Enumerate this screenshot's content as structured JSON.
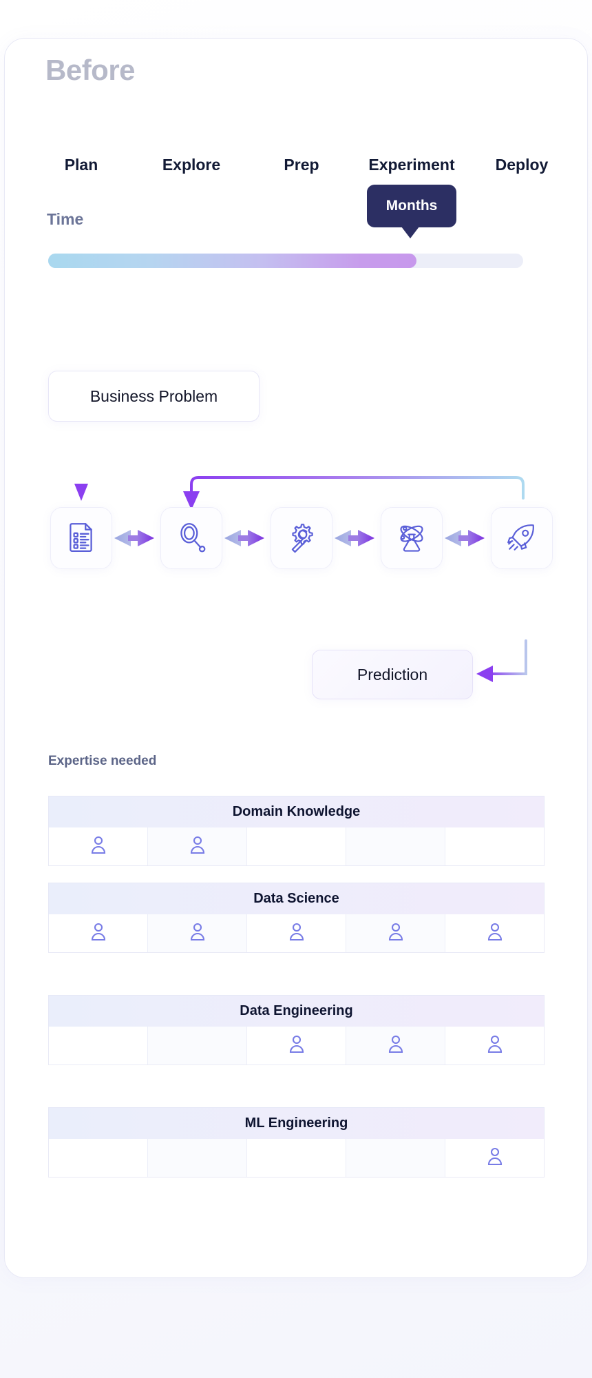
{
  "title": "Before",
  "time_section": {
    "label": "Time",
    "tooltip": "Months",
    "bar_fill_percent": 78
  },
  "flow": {
    "start_box": "Business Problem",
    "end_box": "Prediction",
    "steps": [
      {
        "label": "Plan",
        "icon": "document-list-icon"
      },
      {
        "label": "Explore",
        "icon": "magnifying-glass-icon"
      },
      {
        "label": "Prep",
        "icon": "gear-wrench-icon"
      },
      {
        "label": "Experiment",
        "icon": "atom-flask-icon"
      },
      {
        "label": "Deploy",
        "icon": "rocket-icon"
      }
    ]
  },
  "expertise": {
    "label": "Expertise needed",
    "columns": [
      "Plan",
      "Explore",
      "Prep",
      "Experiment",
      "Deploy"
    ],
    "rows": [
      {
        "name": "Domain Knowledge",
        "cells": [
          true,
          true,
          false,
          false,
          false
        ]
      },
      {
        "name": "Data Science",
        "cells": [
          true,
          true,
          true,
          true,
          true
        ]
      },
      {
        "name": "Data Engineering",
        "cells": [
          false,
          false,
          true,
          true,
          true
        ]
      },
      {
        "name": "ML Engineering",
        "cells": [
          false,
          false,
          false,
          false,
          true
        ]
      }
    ],
    "person_icon": "person-icon"
  },
  "colors": {
    "accent_purple": "#8b3ff0",
    "accent_light_blue": "#a9d8ef",
    "icon_blue": "#5a5fd8",
    "tooltip_navy": "#2c2f63",
    "title_gray": "#b6b9c9",
    "person_icon": "#787ce6"
  },
  "chart_data": {
    "type": "table",
    "title": "Expertise needed",
    "categories": [
      "Plan",
      "Explore",
      "Prep",
      "Experiment",
      "Deploy"
    ],
    "series": [
      {
        "name": "Domain Knowledge",
        "values": [
          1,
          1,
          0,
          0,
          0
        ]
      },
      {
        "name": "Data Science",
        "values": [
          1,
          1,
          1,
          1,
          1
        ]
      },
      {
        "name": "Data Engineering",
        "values": [
          0,
          0,
          1,
          1,
          1
        ]
      },
      {
        "name": "ML Engineering",
        "values": [
          0,
          0,
          0,
          0,
          1
        ]
      }
    ],
    "xlabel": "",
    "ylabel": "",
    "legend": "none",
    "grid": true
  }
}
